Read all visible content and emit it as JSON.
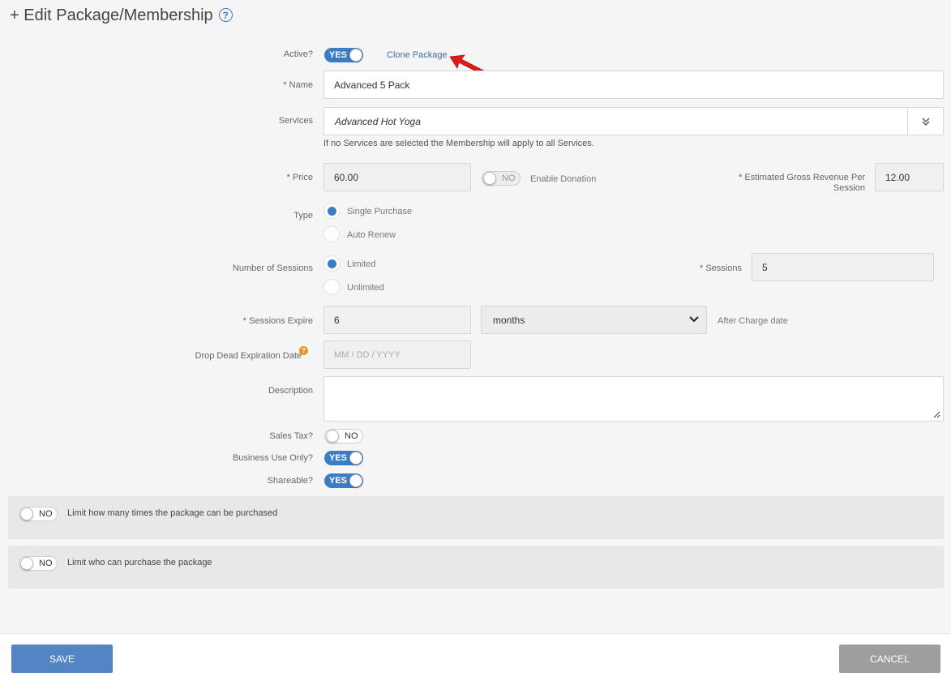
{
  "header": {
    "title": "+ Edit Package/Membership",
    "help_icon": "question-circle-icon"
  },
  "active": {
    "label": "Active?",
    "toggle": "YES",
    "clone_link": "Clone Package"
  },
  "name": {
    "label": "* Name",
    "value": "Advanced 5 Pack"
  },
  "services": {
    "label": "Services",
    "value": "Advanced Hot Yoga",
    "hint": "If no Services are selected the Membership will apply to all Services.",
    "expand_icon": "double-chevron-down-icon"
  },
  "price": {
    "label": "* Price",
    "value": "60.00",
    "donation_toggle": "NO",
    "donation_label": "Enable Donation",
    "gross_label_line1": "* Estimated Gross Revenue Per",
    "gross_label_line2": "Session",
    "gross_value": "12.00"
  },
  "type": {
    "label": "Type",
    "options": [
      "Single Purchase",
      "Auto Renew"
    ],
    "selected": "Single Purchase"
  },
  "sessions_count": {
    "label": "Number of Sessions",
    "options": [
      "Limited",
      "Unlimited"
    ],
    "selected": "Limited",
    "sessions_label": "* Sessions",
    "sessions_value": "5"
  },
  "expire": {
    "label": "* Sessions Expire",
    "value": "6",
    "unit": "months",
    "after": "After Charge date"
  },
  "drop_dead": {
    "label": "Drop Dead Expiration Date",
    "info_icon": "?",
    "placeholder": "MM / DD / YYYY"
  },
  "description": {
    "label": "Description",
    "value": ""
  },
  "sales_tax": {
    "label": "Sales Tax?",
    "toggle": "NO"
  },
  "business_use": {
    "label": "Business Use Only?",
    "toggle": "YES"
  },
  "shareable": {
    "label": "Shareable?",
    "toggle": "YES"
  },
  "limit_purchase": {
    "toggle": "NO",
    "text": "Limit how many times the package can be purchased"
  },
  "limit_who": {
    "toggle": "NO",
    "text": "Limit who can purchase the package"
  },
  "footer": {
    "save": "SAVE",
    "cancel": "CANCEL"
  },
  "colors": {
    "accent": "#3b7dc4",
    "save_button": "#5584c4",
    "cancel_button": "#9e9e9e",
    "arrow": "#e11a1a"
  }
}
